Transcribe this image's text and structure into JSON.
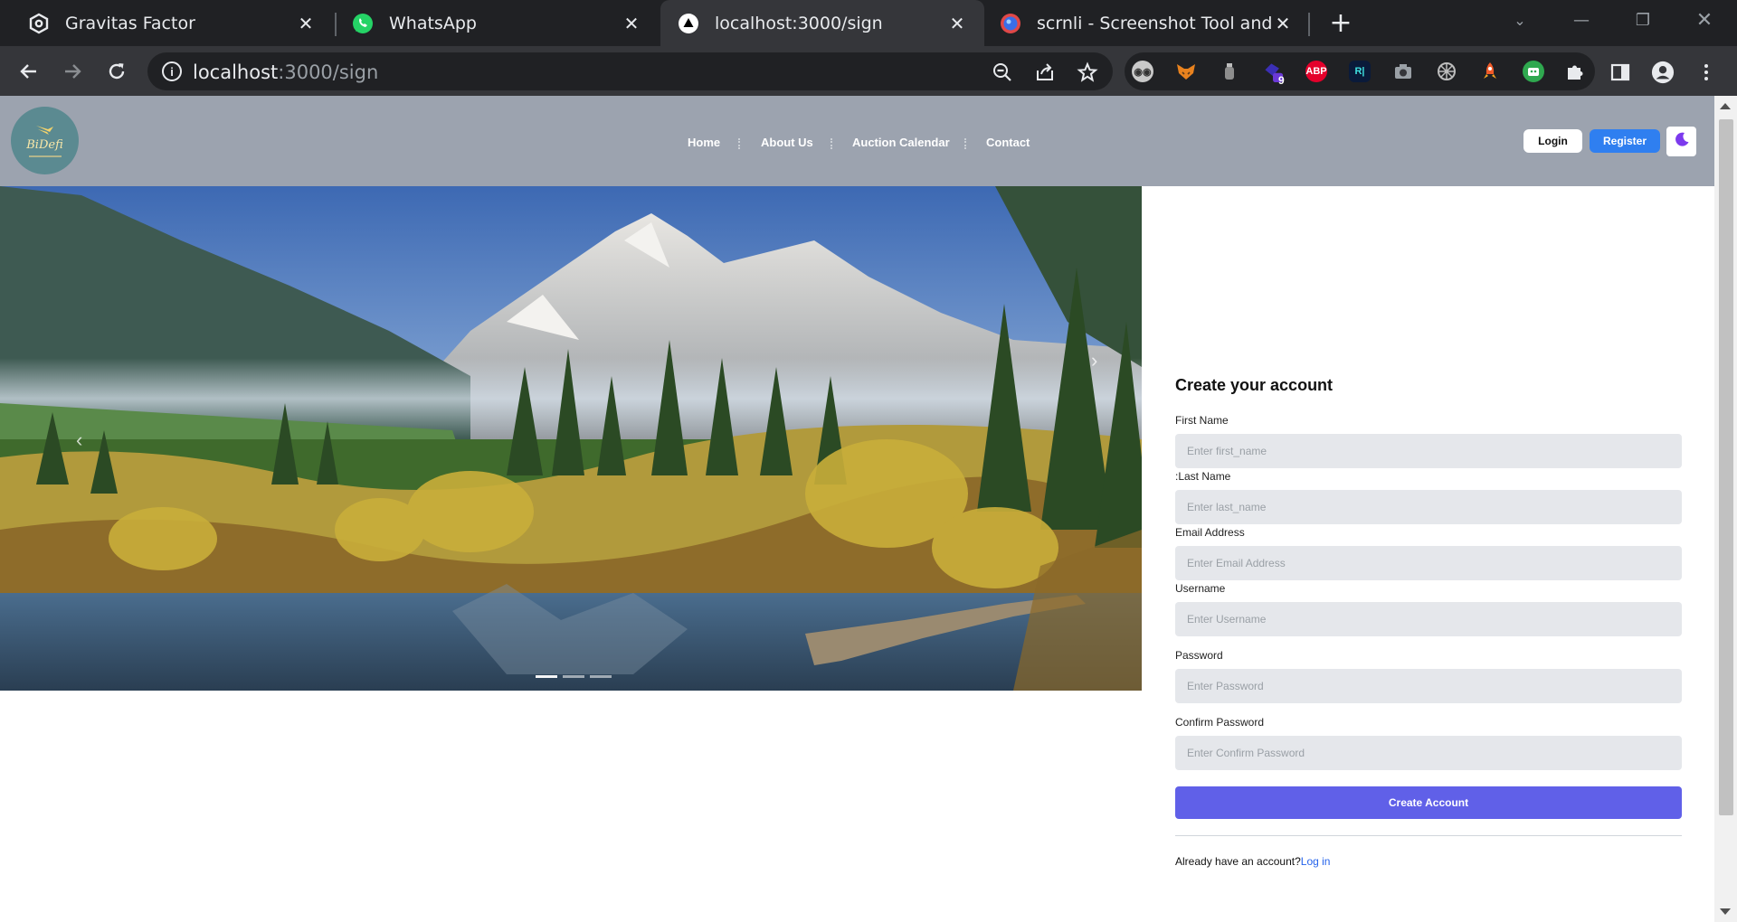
{
  "browser": {
    "tabs": [
      {
        "title": "Gravitas Factor",
        "active": false
      },
      {
        "title": "WhatsApp",
        "active": false
      },
      {
        "title": "localhost:3000/sign",
        "active": true
      },
      {
        "title": "scrnli - Screenshot Tool and Edito",
        "active": false
      }
    ],
    "url_host": "localhost",
    "url_rest": ":3000/sign",
    "extensions": [
      "owl-icon",
      "fox-icon",
      "bottle-icon",
      "diamond-icon",
      "abp-icon",
      "rw-icon",
      "camera-icon",
      "gear-flower-icon",
      "rocket-icon",
      "robot-icon",
      "puzzle-icon"
    ],
    "abp_label": "ABP",
    "badge_count": "9"
  },
  "site": {
    "logo_text": "BiDefi",
    "nav": [
      "Home",
      "About Us",
      "Auction Calendar",
      "Contact"
    ],
    "login_label": "Login",
    "register_label": "Register",
    "colors": {
      "header": "#9ca3af",
      "primary": "#6060e8",
      "register": "#2f7ff0"
    }
  },
  "form": {
    "title": "Create your account",
    "fields": [
      {
        "label": "First Name",
        "placeholder": "Enter first_name"
      },
      {
        "label": ":Last Name",
        "placeholder": "Enter last_name"
      },
      {
        "label": "Email Address",
        "placeholder": "Enter Email Address"
      },
      {
        "label": "Username",
        "placeholder": "Enter Username"
      },
      {
        "label": "Password",
        "placeholder": "Enter Password"
      },
      {
        "label": "Confirm Password",
        "placeholder": "Enter Confirm Password"
      }
    ],
    "submit_label": "Create Account",
    "already_text": "Already have an account?",
    "login_link": "Log in"
  }
}
